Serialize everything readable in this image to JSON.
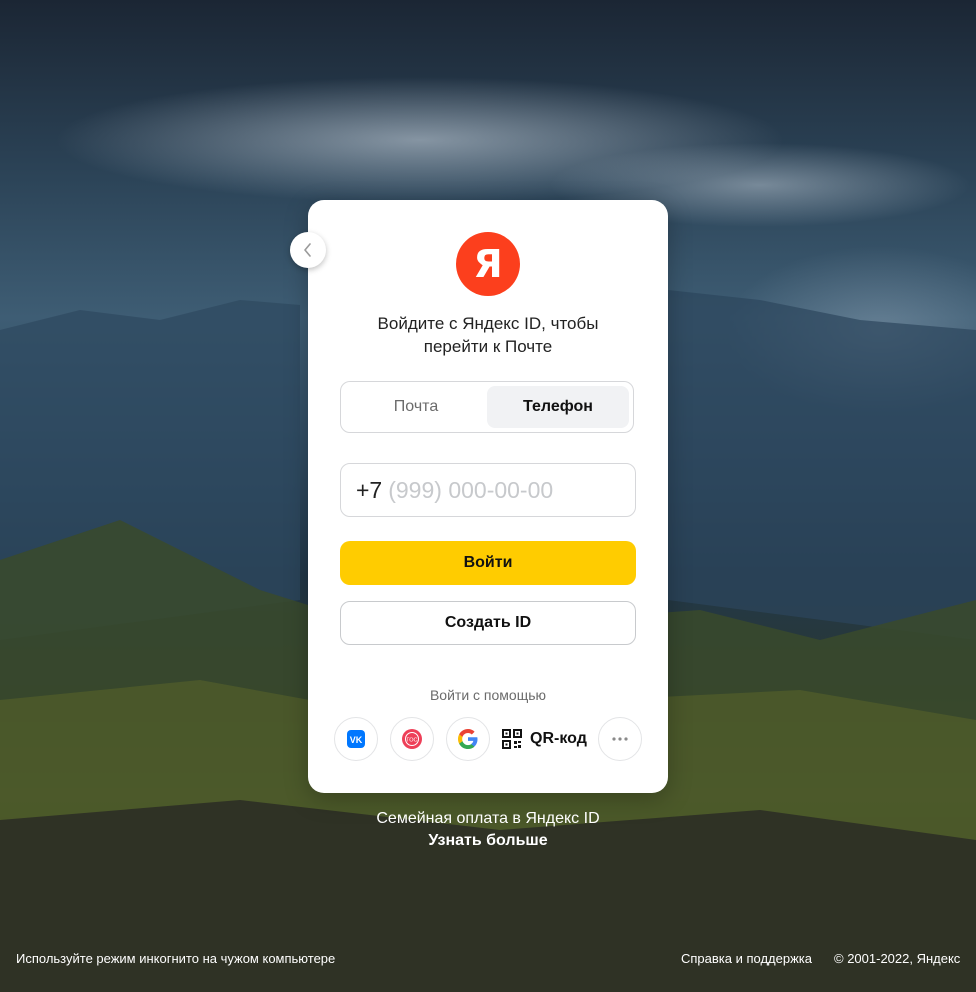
{
  "card": {
    "logo_letter": "Я",
    "title": "Войдите с Яндекс ID, чтобы перейти к Почте",
    "tabs": [
      {
        "label": "Почта",
        "active": false
      },
      {
        "label": "Телефон",
        "active": true
      }
    ],
    "phone": {
      "prefix": "+7",
      "placeholder": "(999) 000-00-00"
    },
    "login_button": "Войти",
    "create_button": "Создать ID",
    "social_label": "Войти с помощью",
    "social": [
      {
        "name": "vk",
        "icon": "vk-icon",
        "text": "VK"
      },
      {
        "name": "gosuslugi",
        "icon": "gosuslugi-icon",
        "text": "ГОС"
      },
      {
        "name": "google",
        "icon": "google-icon"
      },
      {
        "name": "more",
        "icon": "more-dots-icon"
      }
    ],
    "qr_label": "QR-код"
  },
  "promo": {
    "line1": "Семейная оплата в Яндекс ID",
    "link": "Узнать больше"
  },
  "footer": {
    "incognito": "Используйте режим инкогнито на чужом компьютере",
    "help": "Справка и поддержка",
    "copyright": "© 2001-2022, Яндекс"
  },
  "colors": {
    "brand_red": "#fc3f1d",
    "primary_yellow": "#ffcc00",
    "vk_blue": "#0077ff"
  }
}
